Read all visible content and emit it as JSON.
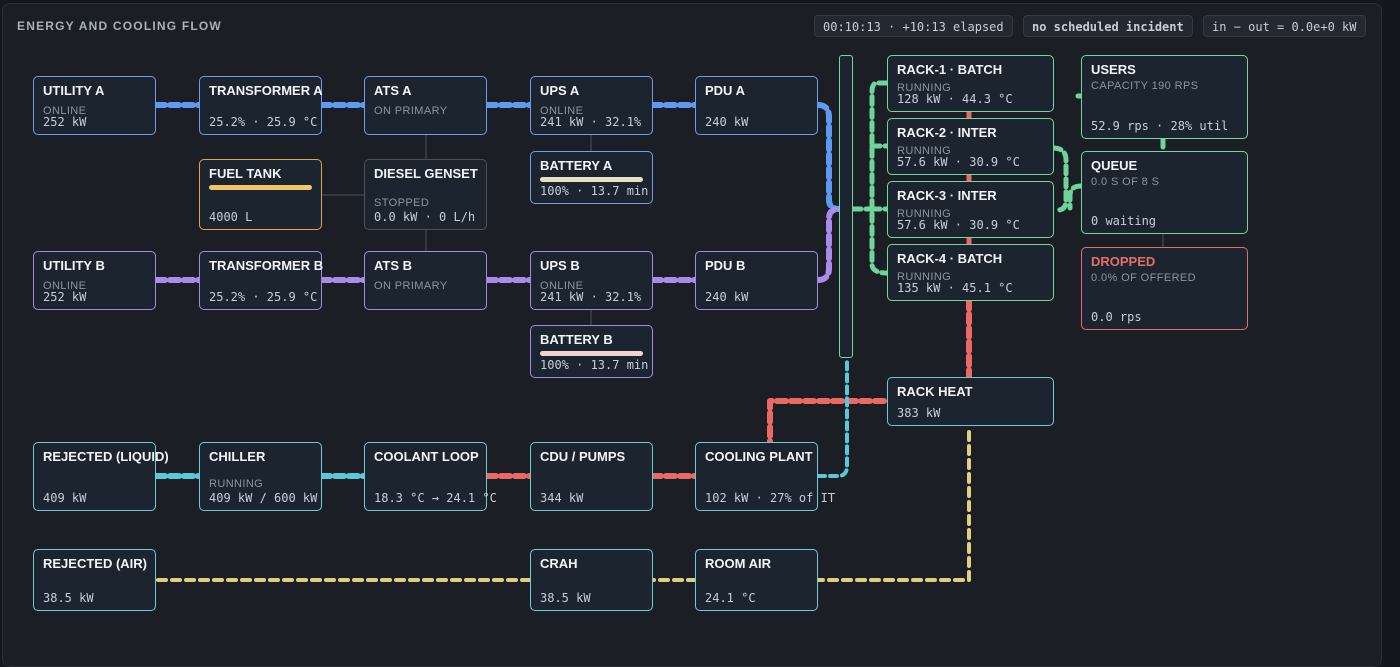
{
  "header": {
    "title": "ENERGY AND COOLING FLOW",
    "time": "00:10:13 · +10:13 elapsed",
    "incident": "no scheduled incident",
    "balance": "in − out = 0.0e+0 kW"
  },
  "colors": {
    "power_a": "#5d9bf0",
    "power_b": "#a98bec",
    "it_load": "#6fd49c",
    "liquid": "#5ac8d8",
    "heat": "#ea6a63",
    "air": "#ddd27a",
    "fuel": "#f4c46b"
  },
  "nodes": {
    "utility_a": {
      "name": "UTILITY A",
      "status": "ONLINE",
      "value": "252 kW"
    },
    "transformer_a": {
      "name": "TRANSFORMER A",
      "value": "25.2% · 25.9 °C"
    },
    "ats_a": {
      "name": "ATS A",
      "status": "ON PRIMARY"
    },
    "ups_a": {
      "name": "UPS A",
      "status": "ONLINE",
      "value": "241 kW · 32.1%"
    },
    "pdu_a": {
      "name": "PDU A",
      "value": "240 kW"
    },
    "fuel_tank": {
      "name": "FUEL TANK",
      "value": "4000 L",
      "level": 1.0
    },
    "diesel_genset": {
      "name": "DIESEL GENSET",
      "status": "STOPPED",
      "value": "0.0 kW · 0 L/h"
    },
    "battery_a": {
      "name": "BATTERY A",
      "value": "100% · 13.7 min",
      "level": 1.0
    },
    "utility_b": {
      "name": "UTILITY B",
      "status": "ONLINE",
      "value": "252 kW"
    },
    "transformer_b": {
      "name": "TRANSFORMER B",
      "value": "25.2% · 25.9 °C"
    },
    "ats_b": {
      "name": "ATS B",
      "status": "ON PRIMARY"
    },
    "ups_b": {
      "name": "UPS B",
      "status": "ONLINE",
      "value": "241 kW · 32.1%"
    },
    "pdu_b": {
      "name": "PDU B",
      "value": "240 kW"
    },
    "battery_b": {
      "name": "BATTERY B",
      "value": "100% · 13.7 min",
      "level": 1.0
    },
    "rack_1": {
      "name": "RACK-1 · BATCH",
      "status": "RUNNING",
      "value": "128 kW · 44.3 °C"
    },
    "rack_2": {
      "name": "RACK-2 · INTER",
      "status": "RUNNING",
      "value": "57.6 kW · 30.9 °C"
    },
    "rack_3": {
      "name": "RACK-3 · INTER",
      "status": "RUNNING",
      "value": "57.6 kW · 30.9 °C"
    },
    "rack_4": {
      "name": "RACK-4 · BATCH",
      "status": "RUNNING",
      "value": "135 kW · 45.1 °C"
    },
    "users": {
      "name": "USERS",
      "status": "CAPACITY 190 RPS",
      "value": "52.9 rps · 28% util"
    },
    "queue": {
      "name": "QUEUE",
      "status": "0.0 S OF 8 S",
      "value": "0 waiting"
    },
    "dropped": {
      "name": "DROPPED",
      "status": "0.0% OF OFFERED",
      "value": "0.0 rps"
    },
    "rack_heat": {
      "name": "RACK HEAT",
      "value": "383 kW"
    },
    "rejected_liquid": {
      "name": "REJECTED (LIQUID)",
      "value": "409 kW"
    },
    "chiller": {
      "name": "CHILLER",
      "status": "RUNNING",
      "value": "409 kW / 600 kW"
    },
    "coolant_loop": {
      "name": "COOLANT LOOP",
      "value": "18.3 °C → 24.1 °C"
    },
    "cdu_pumps": {
      "name": "CDU / PUMPS",
      "value": "344 kW"
    },
    "cooling_plant": {
      "name": "COOLING PLANT",
      "value": "102 kW · 27% of IT"
    },
    "rejected_air": {
      "name": "REJECTED (AIR)",
      "value": "38.5 kW"
    },
    "crah": {
      "name": "CRAH",
      "value": "38.5 kW"
    },
    "room_air": {
      "name": "ROOM AIR",
      "value": "24.1 °C"
    }
  }
}
